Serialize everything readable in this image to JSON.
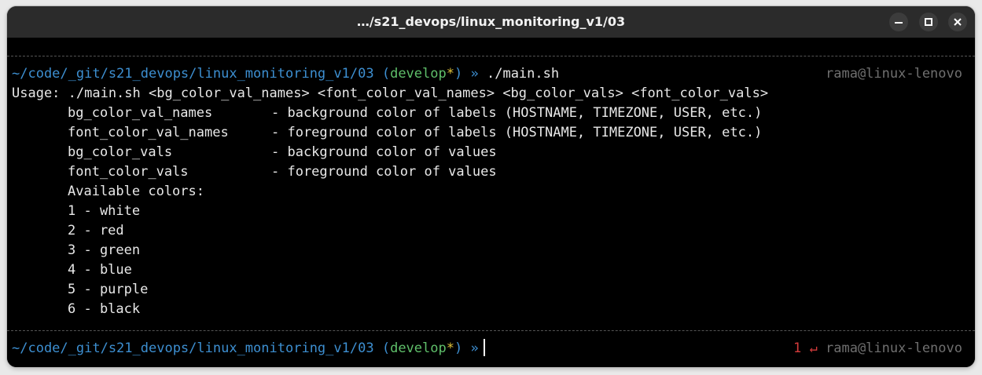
{
  "window": {
    "title": "…/s21_devops/linux_monitoring_v1/03",
    "minimize_label": "–",
    "maximize_label": "▢",
    "close_label": "×"
  },
  "prompt1": {
    "path": "~/code/_git/s21_devops/linux_monitoring_v1/03",
    "open_paren": "(",
    "branch": "develop",
    "dirty": "*",
    "close_paren": ")",
    "chevron": "»",
    "command": "./main.sh",
    "host": "rama@linux-lenovo"
  },
  "output": {
    "usage": "Usage: ./main.sh <bg_color_val_names> <font_color_val_names> <bg_color_vals> <font_color_vals>",
    "params": [
      {
        "name": "bg_color_val_names",
        "desc": "- background color of labels (HOSTNAME, TIMEZONE, USER, etc.)"
      },
      {
        "name": "font_color_val_names",
        "desc": "- foreground color of labels (HOSTNAME, TIMEZONE, USER, etc.)"
      },
      {
        "name": "bg_color_vals",
        "desc": "- background color of values"
      },
      {
        "name": "font_color_vals",
        "desc": "- foreground color of values"
      }
    ],
    "available": "Available colors:",
    "colors": [
      "1 - white",
      "2 - red",
      "3 - green",
      "4 - blue",
      "5 - purple",
      "6 - black"
    ]
  },
  "prompt2": {
    "path": "~/code/_git/s21_devops/linux_monitoring_v1/03",
    "open_paren": "(",
    "branch": "develop",
    "dirty": "*",
    "close_paren": ")",
    "chevron": "»",
    "exit_code": "1",
    "exit_icon": "↵",
    "host": "rama@linux-lenovo"
  },
  "colors": {
    "path": "#3d8fd1",
    "branch": "#5fbf6a",
    "dirty": "#e0c23a",
    "error": "#d43b3b",
    "host": "#6f6f6f"
  }
}
